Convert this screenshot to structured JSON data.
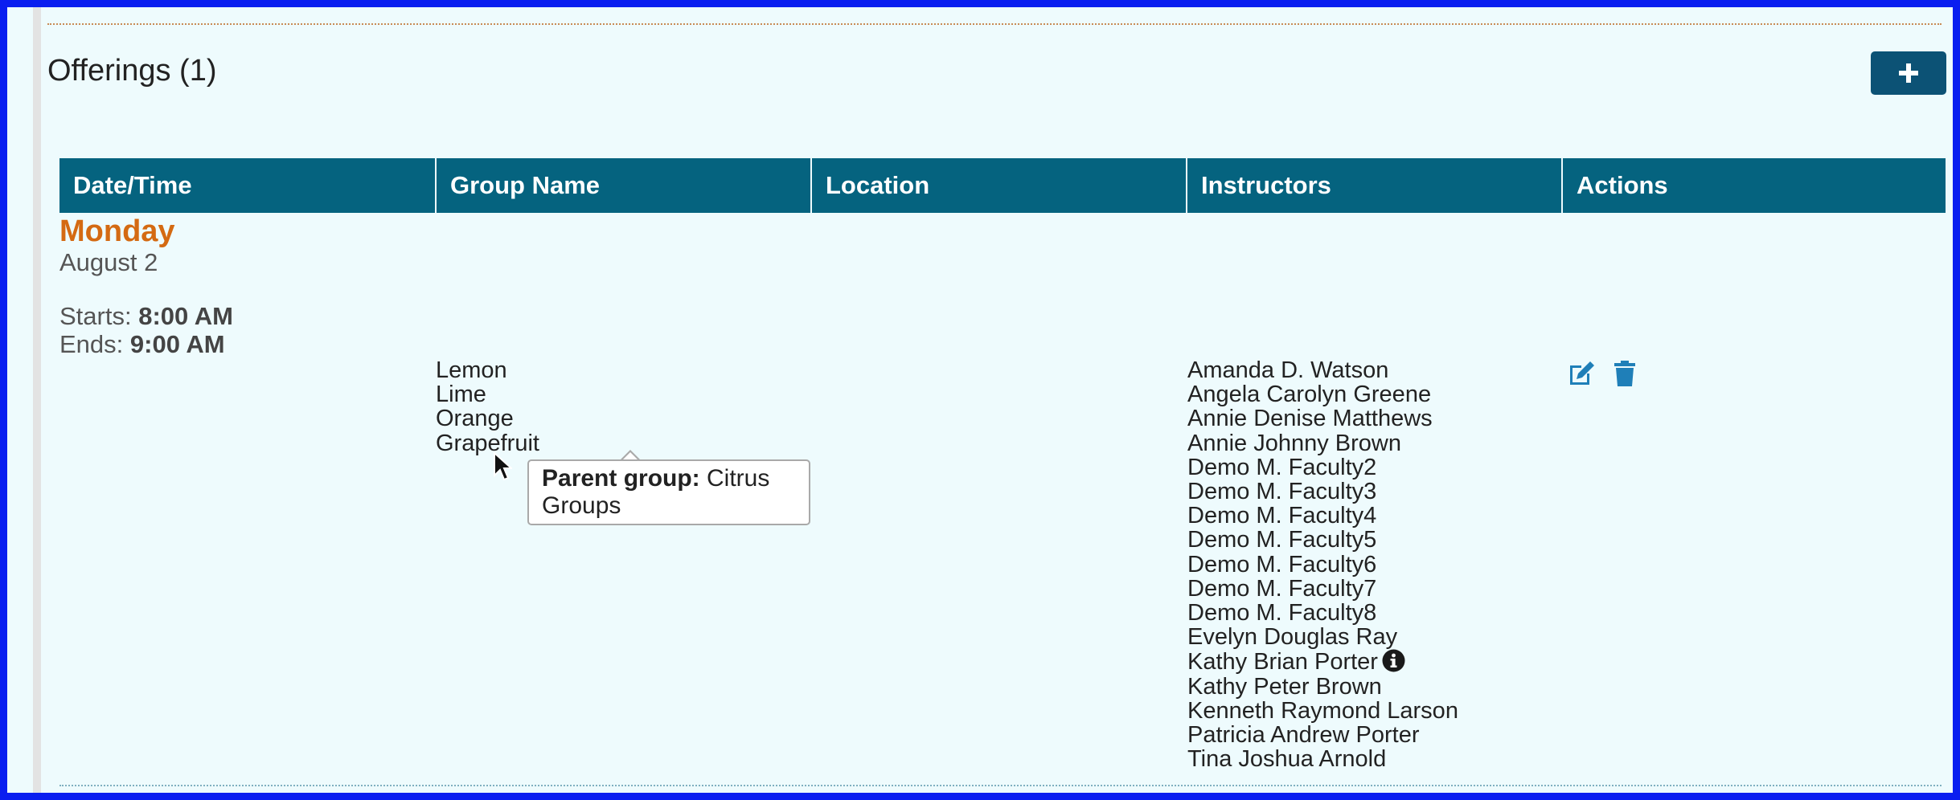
{
  "section": {
    "title": "Offerings (1)",
    "add_label": "+"
  },
  "table": {
    "headers": [
      "Date/Time",
      "Group Name",
      "Location",
      "Instructors",
      "Actions"
    ]
  },
  "offering": {
    "day": "Monday",
    "date": "August 2",
    "starts_label": "Starts:",
    "starts_value": "8:00 AM",
    "ends_label": "Ends:",
    "ends_value": "9:00 AM",
    "groups": [
      "Lemon",
      "Lime",
      "Orange",
      "Grapefruit"
    ],
    "location": "",
    "instructors": [
      "Amanda D. Watson",
      "Angela Carolyn Greene",
      "Annie Denise Matthews",
      "Annie Johnny Brown",
      "Demo M. Faculty2",
      "Demo M. Faculty3",
      "Demo M. Faculty4",
      "Demo M. Faculty5",
      "Demo M. Faculty6",
      "Demo M. Faculty7",
      "Demo M. Faculty8",
      "Evelyn Douglas Ray",
      "Kathy Brian Porter",
      "Kathy Peter Brown",
      "Kenneth Raymond Larson",
      "Patricia Andrew Porter",
      "Tina Joshua Arnold"
    ]
  },
  "tooltip": {
    "label": "Parent group:",
    "value": "Citrus Groups"
  },
  "icons": {
    "add": "plus-icon",
    "edit": "edit-icon",
    "delete": "trash-icon",
    "info": "info-icon",
    "cursor": "mouse-pointer-icon"
  },
  "colors": {
    "frame": "#0a1ef0",
    "background": "#eefbfd",
    "header": "#05637f",
    "button": "#0c5275",
    "day": "#d46a12",
    "action_icon": "#1f7fb8"
  }
}
